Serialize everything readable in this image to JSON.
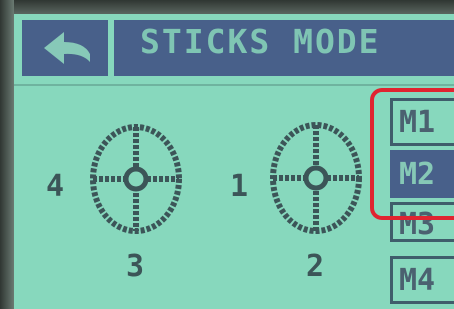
{
  "header": {
    "back_icon": "back-arrow-icon",
    "title": "STICKS MODE"
  },
  "sticks": [
    {
      "left_label": "4",
      "bottom_label": "3"
    },
    {
      "left_label": "1",
      "bottom_label": "2"
    }
  ],
  "modes": [
    {
      "label": "M1",
      "selected": false
    },
    {
      "label": "M2",
      "selected": true
    },
    {
      "label": "M3",
      "selected": false
    },
    {
      "label": "M4",
      "selected": false
    }
  ],
  "colors": {
    "screen_bg": "#87d8bd",
    "header_bg": "#48608a",
    "ink": "#3c5558",
    "highlight": "#e02430"
  }
}
